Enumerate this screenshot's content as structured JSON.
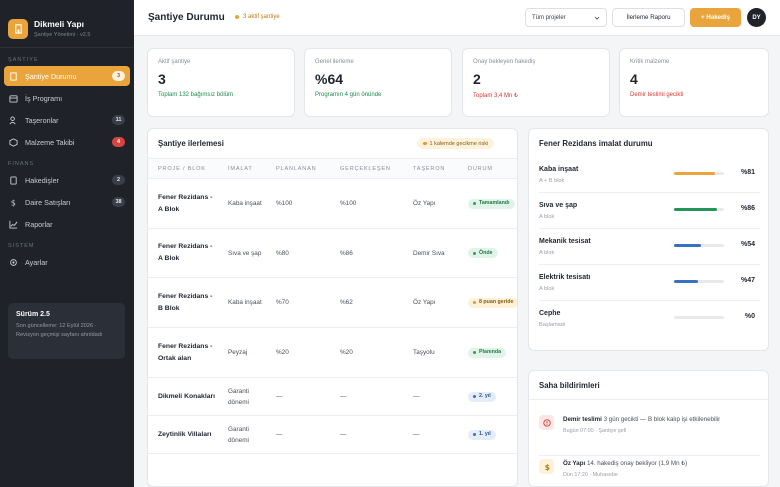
{
  "brand": {
    "title": "Dikmeli Yapı",
    "subtitle": "Şantiye Yönetimi · v2.5"
  },
  "sidebar": {
    "sections": {
      "santiye": "Şantiye",
      "finans": "Finans",
      "sistem": "Sistem"
    },
    "items": [
      {
        "label": "Şantiye Durumu",
        "badge": "3"
      },
      {
        "label": "İş Programı",
        "badge": ""
      },
      {
        "label": "Taşeronlar",
        "badge": "11"
      },
      {
        "label": "Malzeme Takibi",
        "badge": "4"
      },
      {
        "label": "Hakedişler",
        "badge": "2"
      },
      {
        "label": "Daire Satışları",
        "badge": "38"
      },
      {
        "label": "Raporlar",
        "badge": ""
      },
      {
        "label": "Ayarlar",
        "badge": ""
      }
    ],
    "version": {
      "title": "Sürüm 2.5",
      "text": "Son güncelleme: 12 Eylül 2026 · Revizyon geçmişi sayfanı ahrıldadı"
    }
  },
  "header": {
    "title": "Şantiye Durumu",
    "status": "3 aktif şantiye",
    "project_select": "Tüm projeler",
    "report_button": "İlerleme Raporu",
    "add_button": "+ Hakediş",
    "avatar": "DY"
  },
  "kpis": [
    {
      "label": "Aktif şantiye",
      "value": "3",
      "note": "Toplam 132 bağımsız bölüm",
      "tone": "green"
    },
    {
      "label": "Genel ilerleme",
      "value": "%64",
      "note": "Programın 4 gün önünde",
      "tone": "green"
    },
    {
      "label": "Onay bekleyen hakediş",
      "value": "2",
      "note": "Toplam 3,4 Mn ₺",
      "tone": "red"
    },
    {
      "label": "Kritik malzeme",
      "value": "4",
      "note": "Demir teslimi gecikti",
      "tone": "red"
    }
  ],
  "progress_table": {
    "title": "Şantiye ilerlemesi",
    "risk_badge": "1 kalemde gecikme riski",
    "columns": [
      "Proje / Blok",
      "İmalat",
      "Planlanan",
      "Gerçekleşen",
      "Taşeron",
      "Durum"
    ],
    "rows": [
      {
        "project": "Fener Rezidans - A Blok",
        "work": "Kaba inşaat",
        "planned": "%100",
        "actual": "%100",
        "contractor": "Öz Yapı",
        "status": "Tamamlandı",
        "tone": "green-p"
      },
      {
        "project": "Fener Rezidans - A Blok",
        "work": "Sıva ve şap",
        "planned": "%80",
        "actual": "%86",
        "contractor": "Demir Sıva",
        "status": "Önde",
        "tone": "green-p"
      },
      {
        "project": "Fener Rezidans - B Blok",
        "work": "Kaba inşaat",
        "planned": "%70",
        "actual": "%62",
        "contractor": "Öz Yapı",
        "status": "8 puan geride",
        "tone": "amber-p"
      },
      {
        "project": "Fener Rezidans - Ortak alan",
        "work": "Peyzaj",
        "planned": "%20",
        "actual": "%20",
        "contractor": "Taşyolu",
        "status": "Planında",
        "tone": "green-p"
      },
      {
        "project": "Dikmeli Konakları",
        "work": "Garanti dönemi",
        "planned": "—",
        "actual": "—",
        "contractor": "—",
        "status": "2. yıl",
        "tone": "blue-p"
      },
      {
        "project": "Zeytinlik Villaları",
        "work": "Garanti dönemi",
        "planned": "—",
        "actual": "—",
        "contractor": "—",
        "status": "1. yıl",
        "tone": "blue-p"
      }
    ]
  },
  "manufacturing": {
    "title": "Fener Rezidans imalat durumu",
    "items": [
      {
        "name": "Kaba inşaat",
        "sub": "A + B blok",
        "value": "%81",
        "percent": 81,
        "color": "#e9a53b"
      },
      {
        "name": "Sıva ve şap",
        "sub": "A blok",
        "value": "%86",
        "percent": 86,
        "color": "#23955a"
      },
      {
        "name": "Mekanik tesisat",
        "sub": "A blok",
        "value": "%54",
        "percent": 54,
        "color": "#3b6fc1"
      },
      {
        "name": "Elektrik tesisatı",
        "sub": "A blok",
        "value": "%47",
        "percent": 47,
        "color": "#3b6fc1"
      },
      {
        "name": "Cephe",
        "sub": "Başlamadı",
        "value": "%0",
        "percent": 0,
        "color": "#3b6fc1"
      }
    ]
  },
  "notifications": {
    "title": "Saha bildirimleri",
    "items": [
      {
        "strong": "Demir teslimi",
        "text": "3 gün gecikti — B blok kalıp işi etkilenebilir",
        "time": "Bugün 07:00 · Şantiye şefi",
        "icon": "alert-icon",
        "bg": "#fde7e6",
        "fg": "#d23b35"
      },
      {
        "strong": "Öz Yapı",
        "text": "14. hakediş onay bekliyor (1,9 Mn ₺)",
        "time": "Dün 17:20 · Muhasebe",
        "icon": "lira-icon",
        "bg": "#fdf1d8",
        "fg": "#b57512"
      }
    ]
  }
}
